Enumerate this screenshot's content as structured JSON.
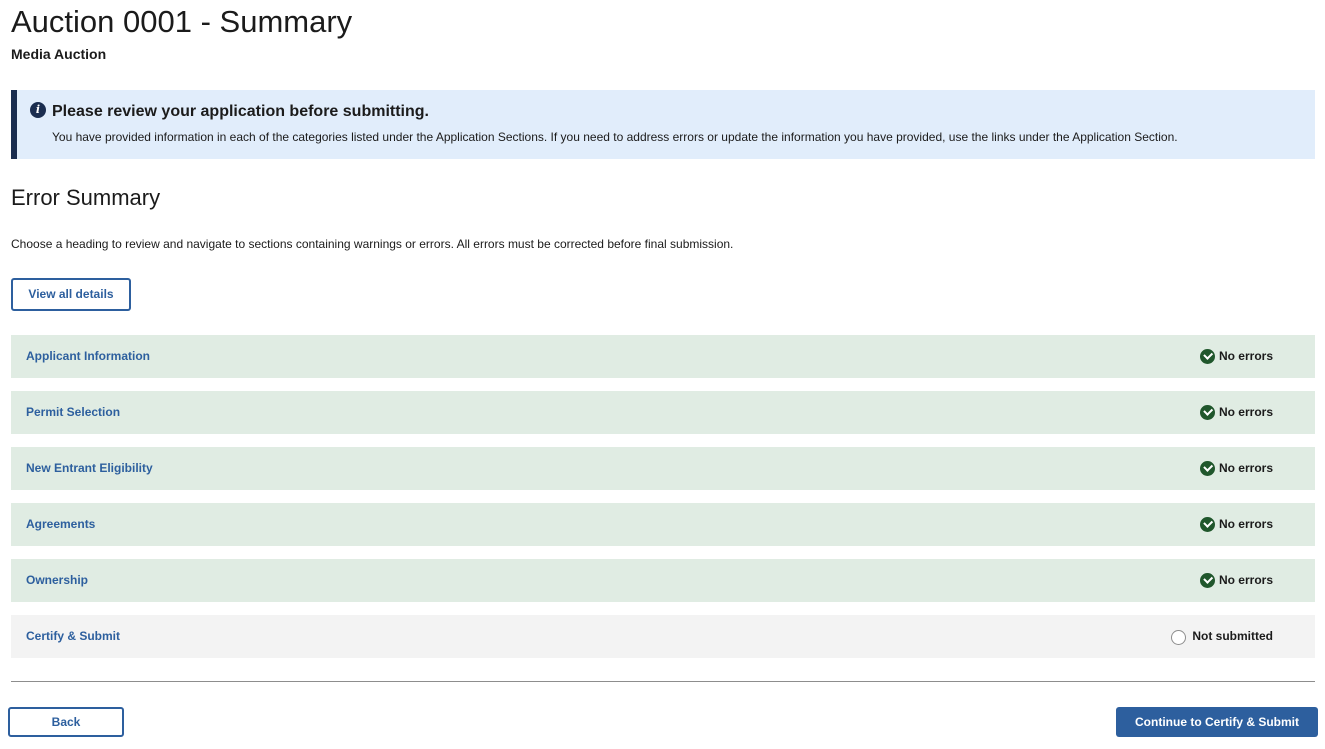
{
  "page": {
    "title": "Auction 0001 - Summary",
    "subtitle": "Media Auction"
  },
  "alert": {
    "icon": "info-icon",
    "heading": "Please review your application before submitting.",
    "body": "You have provided information in each of the categories listed under the Application Sections. If you need to address errors or update the information you have provided, use the links under the Application Section."
  },
  "error_summary": {
    "heading": "Error Summary",
    "description": "Choose a heading to review and navigate to sections containing warnings or errors. All errors must be corrected before final submission.",
    "view_all_label": "View all details"
  },
  "sections": [
    {
      "label": "Applicant Information",
      "status": "No errors",
      "state": "complete",
      "icon": "check-circle-icon"
    },
    {
      "label": "Permit Selection",
      "status": "No errors",
      "state": "complete",
      "icon": "check-circle-icon"
    },
    {
      "label": "New Entrant Eligibility",
      "status": "No errors",
      "state": "complete",
      "icon": "check-circle-icon"
    },
    {
      "label": "Agreements",
      "status": "No errors",
      "state": "complete",
      "icon": "check-circle-icon"
    },
    {
      "label": "Ownership",
      "status": "No errors",
      "state": "complete",
      "icon": "check-circle-icon"
    },
    {
      "label": "Certify & Submit",
      "status": "Not submitted",
      "state": "pending",
      "icon": "empty-circle-icon"
    }
  ],
  "footer": {
    "back_label": "Back",
    "continue_label": "Continue to Certify & Submit"
  },
  "colors": {
    "primary": "#2d5f9e",
    "alert_background": "#e1edfb",
    "alert_border": "#1a2d4f",
    "complete_row": "#e0ece3",
    "pending_row": "#f3f3f3",
    "success_icon": "#20572c"
  }
}
